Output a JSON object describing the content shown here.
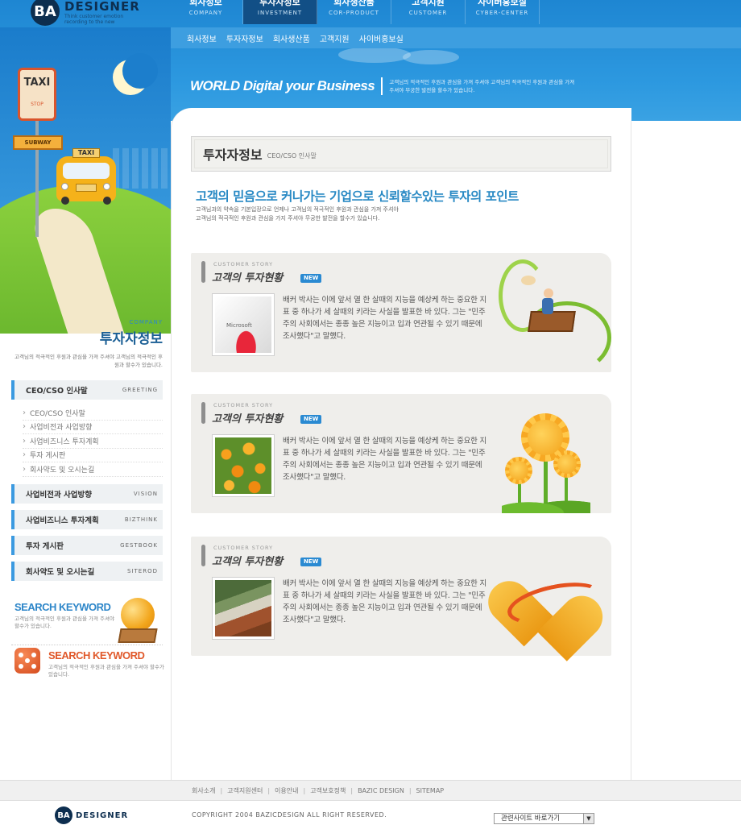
{
  "brand": {
    "badge": "BA",
    "name": "DESIGNER",
    "tagline": "Think customer emotion recording to the new"
  },
  "main_nav": [
    {
      "ko": "회사정보",
      "en": "COMPANY"
    },
    {
      "ko": "투자자정보",
      "en": "INVESTMENT"
    },
    {
      "ko": "회사생산품",
      "en": "COR-PRODUCT"
    },
    {
      "ko": "고객지원",
      "en": "CUSTOMER"
    },
    {
      "ko": "사이버홍보실",
      "en": "CYBER-CENTER"
    }
  ],
  "sub_nav": [
    "회사정보",
    "투자자정보",
    "회사생산품",
    "고객지원",
    "사이버홍보실"
  ],
  "slogan": {
    "main": "WORLD Digital your Business",
    "sub": "고객님의 적극적인 후원과 관심을 가져 주셔야 고객님의 적극적인 후원과 관심을 가져 주셔야 무궁한 발전을 할수가 있습니다."
  },
  "illustration": {
    "taxi_sign": "TAXI",
    "stop": "STOP",
    "subway": "SUBWAY",
    "taxi_roof": "TAXI"
  },
  "section": {
    "en": "COMPANY",
    "ko": "투자자정보",
    "desc": "고객님의 적극적인 후원과 관심을 가져 주셔야 고객님의 적극적인 후원과 할수가 있습니다."
  },
  "menu": {
    "items": [
      {
        "ko": "CEO/CSO 인사말",
        "en": "GREETING"
      },
      {
        "ko": "사업비전과 사업방향",
        "en": "VISION"
      },
      {
        "ko": "사업비즈니스 투자계획",
        "en": "BIZTHINK"
      },
      {
        "ko": "투자 게시판",
        "en": "GESTBOOK"
      },
      {
        "ko": "회사약도 및 오시는길",
        "en": "SITEROD"
      }
    ],
    "subitems": [
      "CEO/CSO 인사말",
      "사업비전과 사업방향",
      "사업비즈니스 투자계획",
      "투자 게시판",
      "회사약도 및 오시는길"
    ]
  },
  "keywords": [
    {
      "title": "SEARCH KEYWORD",
      "desc": "고객님의 적극적인 후원과 관심을 가져 주셔야 할수가 있습니다.",
      "color": "#2d86c9"
    },
    {
      "title": "SEARCH KEYWORD",
      "desc": "고객님의 적극적인 후원과 관심을 가져 주셔야 할수가 있습니다.",
      "color": "#e0582a"
    }
  ],
  "page": {
    "title": "투자자정보",
    "subtitle": "CEO/CSO 인사말",
    "headline": "고객의 믿음으로 커나가는 기업으로 신뢰할수있는 투자의 포인트",
    "headline_desc_1": "고객님과의 약속을 기본입장으로 언제나  고객님의 적극적인 후원과 관심을 가져 주셔야",
    "headline_desc_2": "고객님의 적극적인 후원과 관심을 가지 주셔야 무궁한 발전을 할수가 있습니다."
  },
  "stories": [
    {
      "label_en": "CUSTOMER STORY",
      "label_ko": "고객의 투자현황",
      "badge": "NEW",
      "thumb_text": "Microsoft",
      "text": "배커 박사는 이에 앞서 열 한 살때의 지능을 예상케 하는 중요한 지표 중 하나가 세 살때의 키라는 사실을 발표한 바 있다. 그는 \"민주주의 사회에서는 종종 높은 지능이고 입과 연관될 수 있기 때문에 조사했다\"고 말했다."
    },
    {
      "label_en": "CUSTOMER STORY",
      "label_ko": "고객의 투자현황",
      "badge": "NEW",
      "text": "배커 박사는 이에 앞서 열 한 살때의 지능을 예상케 하는 중요한 지표 중 하나가 세 살때의 키라는 사실을 발표한 바 있다. 그는 \"민주주의 사회에서는 종종 높은 지능이고 입과 연관될 수 있기 때문에 조사했다\"고 말했다."
    },
    {
      "label_en": "CUSTOMER STORY",
      "label_ko": "고객의 투자현황",
      "badge": "NEW",
      "text": "배커 박사는 이에 앞서 열 한 살때의 지능을 예상케 하는 중요한 지표 중 하나가 세 살때의 키라는 사실을 발표한 바 있다. 그는 \"민주주의 사회에서는 종종 높은 지능이고 입과 연관될 수 있기 때문에 조사했다\"고 말했다."
    }
  ],
  "footer": {
    "links": [
      "회사소개",
      "고객지원센터",
      "이용안내",
      "고객보호정책",
      "BAZIC DESIGN",
      "SITEMAP"
    ],
    "copyright": "COPYRIGHT  2004 BAZICDESIGN ALL RIGHT RESERVED.",
    "related_label": "관련사이트 바로가기",
    "logo_badge": "BA",
    "logo_name": "DESIGNER"
  },
  "colors": {
    "primary": "#2d99e0",
    "nav_active": "#124f86",
    "accent_text": "#2889c4",
    "panel": "#efeeeb"
  }
}
